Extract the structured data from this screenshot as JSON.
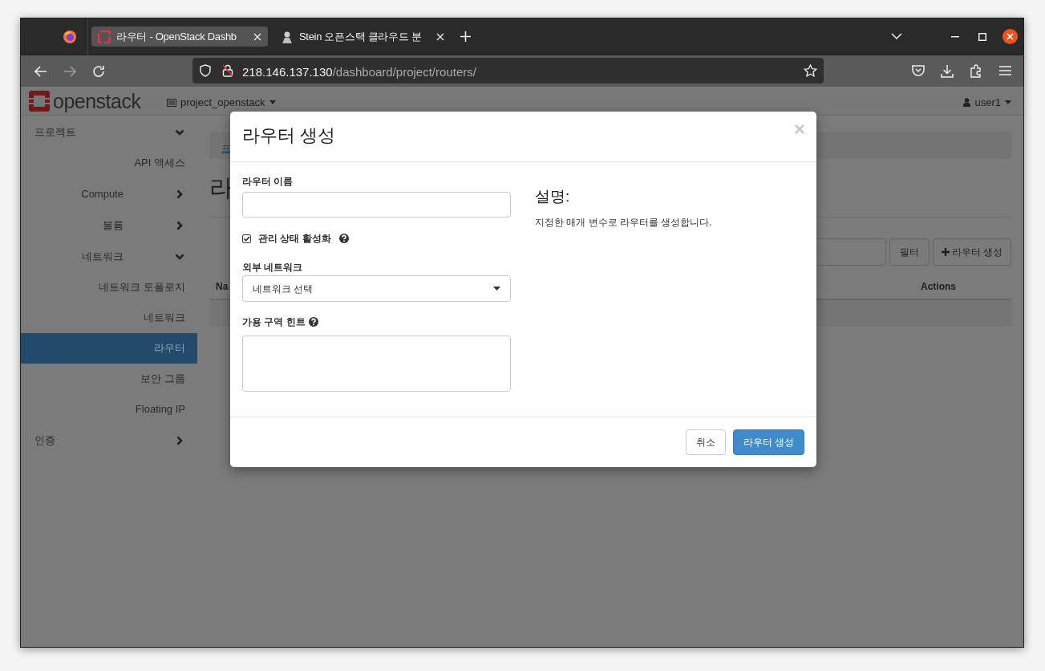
{
  "browser": {
    "tabs": [
      {
        "title": "라우터 - OpenStack Dashb",
        "selected": true
      },
      {
        "title": "Stein 오픈스택 클라우드 분",
        "selected": false
      }
    ],
    "url_host": "218.146.137.130",
    "url_path": "/dashboard/project/routers/"
  },
  "header": {
    "logo": "openstack",
    "project": "project_openstack",
    "user": "user1"
  },
  "sidebar": {
    "items": [
      {
        "label": "프로젝트",
        "kind": "section",
        "expanded": true,
        "children": [
          {
            "label": "API 액세스",
            "kind": "link",
            "selected": false
          },
          {
            "label": "Compute",
            "kind": "group",
            "expanded": false
          },
          {
            "label": "볼륨",
            "kind": "group",
            "expanded": false
          },
          {
            "label": "네트워크",
            "kind": "group",
            "expanded": true,
            "children": [
              {
                "label": "네트워크 토폴로지",
                "kind": "link",
                "selected": false
              },
              {
                "label": "네트워크",
                "kind": "link",
                "selected": false
              },
              {
                "label": "라우터",
                "kind": "link",
                "selected": true
              },
              {
                "label": "보안 그룹",
                "kind": "link",
                "selected": false
              },
              {
                "label": "Floating IP",
                "kind": "link",
                "selected": false
              }
            ]
          }
        ]
      },
      {
        "label": "인증",
        "kind": "section",
        "expanded": false
      }
    ]
  },
  "page": {
    "breadcrumb": "프",
    "heading": "라",
    "filter_button": "필터",
    "create_button": "라우터 생성",
    "table": {
      "columns": [
        "Na",
        "Actions"
      ]
    }
  },
  "dialog": {
    "title": "라우터 생성",
    "close": "×",
    "name_field": {
      "label": "라우터 이름"
    },
    "admin_state": {
      "label": "관리 상태 활성화",
      "checked": true
    },
    "external_network": {
      "label": "외부 네트워크",
      "value": "네트워크 선택"
    },
    "az_hints": {
      "label": "가용 구역 힌트"
    },
    "description": {
      "heading": "설명:",
      "text": "지정한 매개 변수로 라우터를 생성합니다."
    },
    "buttons": [
      "취소",
      "라우터 생성"
    ]
  }
}
